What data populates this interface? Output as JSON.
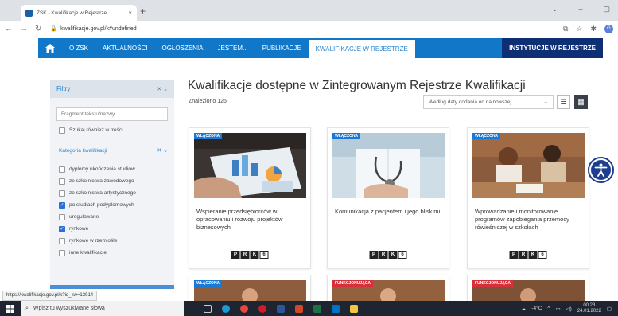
{
  "browser": {
    "tab_title": "ZSK - Kwalifikacje w Rejestrze",
    "tab_close": "×",
    "new_tab": "+",
    "url": "kwalifikacje.gov.pl/k#undefined",
    "win_min": "–",
    "win_max": "▢",
    "profile": "G"
  },
  "nav": {
    "items": [
      "O ZSK",
      "AKTUALNOŚCI",
      "OGŁOSZENIA",
      "JESTEM...",
      "PUBLIKACJE",
      "KWALIFIKACJE W REJESTRZE",
      "INSTYTUCJE W REJESTRZE"
    ],
    "active_index": 5
  },
  "sidebar": {
    "header": "Filtry",
    "search_placeholder": "Fragment tekstu/nazwy...",
    "search_in_content": "Szukaj również w treści",
    "category_header": "Kategoria kwalifikacji",
    "categories": [
      {
        "label": "dyplomy ukończenia studiów",
        "checked": false
      },
      {
        "label": "ze szkolnictwa zawodowego",
        "checked": false
      },
      {
        "label": "ze szkolnictwa artystycznego",
        "checked": false
      },
      {
        "label": "po studiach podyplomowych",
        "checked": true
      },
      {
        "label": "uregulowane",
        "checked": false
      },
      {
        "label": "rynkowe",
        "checked": true
      },
      {
        "label": "rynkowe w rzemiośle",
        "checked": false
      },
      {
        "label": "inne kwalifikacje",
        "checked": false
      }
    ]
  },
  "main": {
    "title": "Kwalifikacje dostępne w Zintegrowanym Rejestrze Kwalifikacji",
    "found": "Znaleziono 125",
    "sort_label": "Według daty dodania od najnowszej",
    "cards": [
      {
        "badge": "WŁĄCZONA",
        "title": "Wspieranie przedsiębiorców w opracowaniu i rozwoju projektów biznesowych",
        "level": "6"
      },
      {
        "badge": "WŁĄCZONA",
        "title": "Komunikacja z pacjentem i jego bliskimi",
        "level": "6"
      },
      {
        "badge": "WŁĄCZONA",
        "title": "Wprowadzanie i monitorowanie programów zapobiegania przemocy rówieśniczej w szkołach",
        "level": "6"
      }
    ],
    "bottom_badges": [
      "WŁĄCZONA",
      "FUNKCJONUJĄCA",
      "FUNKCJONUJĄCA"
    ],
    "prk_letters": [
      "P",
      "R",
      "K"
    ]
  },
  "status_url": "https://kwalifikacje.gov.pl/k?id_kw=13914",
  "taskbar": {
    "search_placeholder": "Wpisz tu wyszukiwane słowa",
    "weather": "-4°C",
    "time": "00:23",
    "date": "24.01.2022"
  },
  "colors": {
    "nav_blue": "#1178c9",
    "nav_dark": "#0e2f74",
    "badge_blue": "#1a78d6",
    "badge_red": "#d6303a",
    "checkbox_on": "#2a6fd6"
  }
}
